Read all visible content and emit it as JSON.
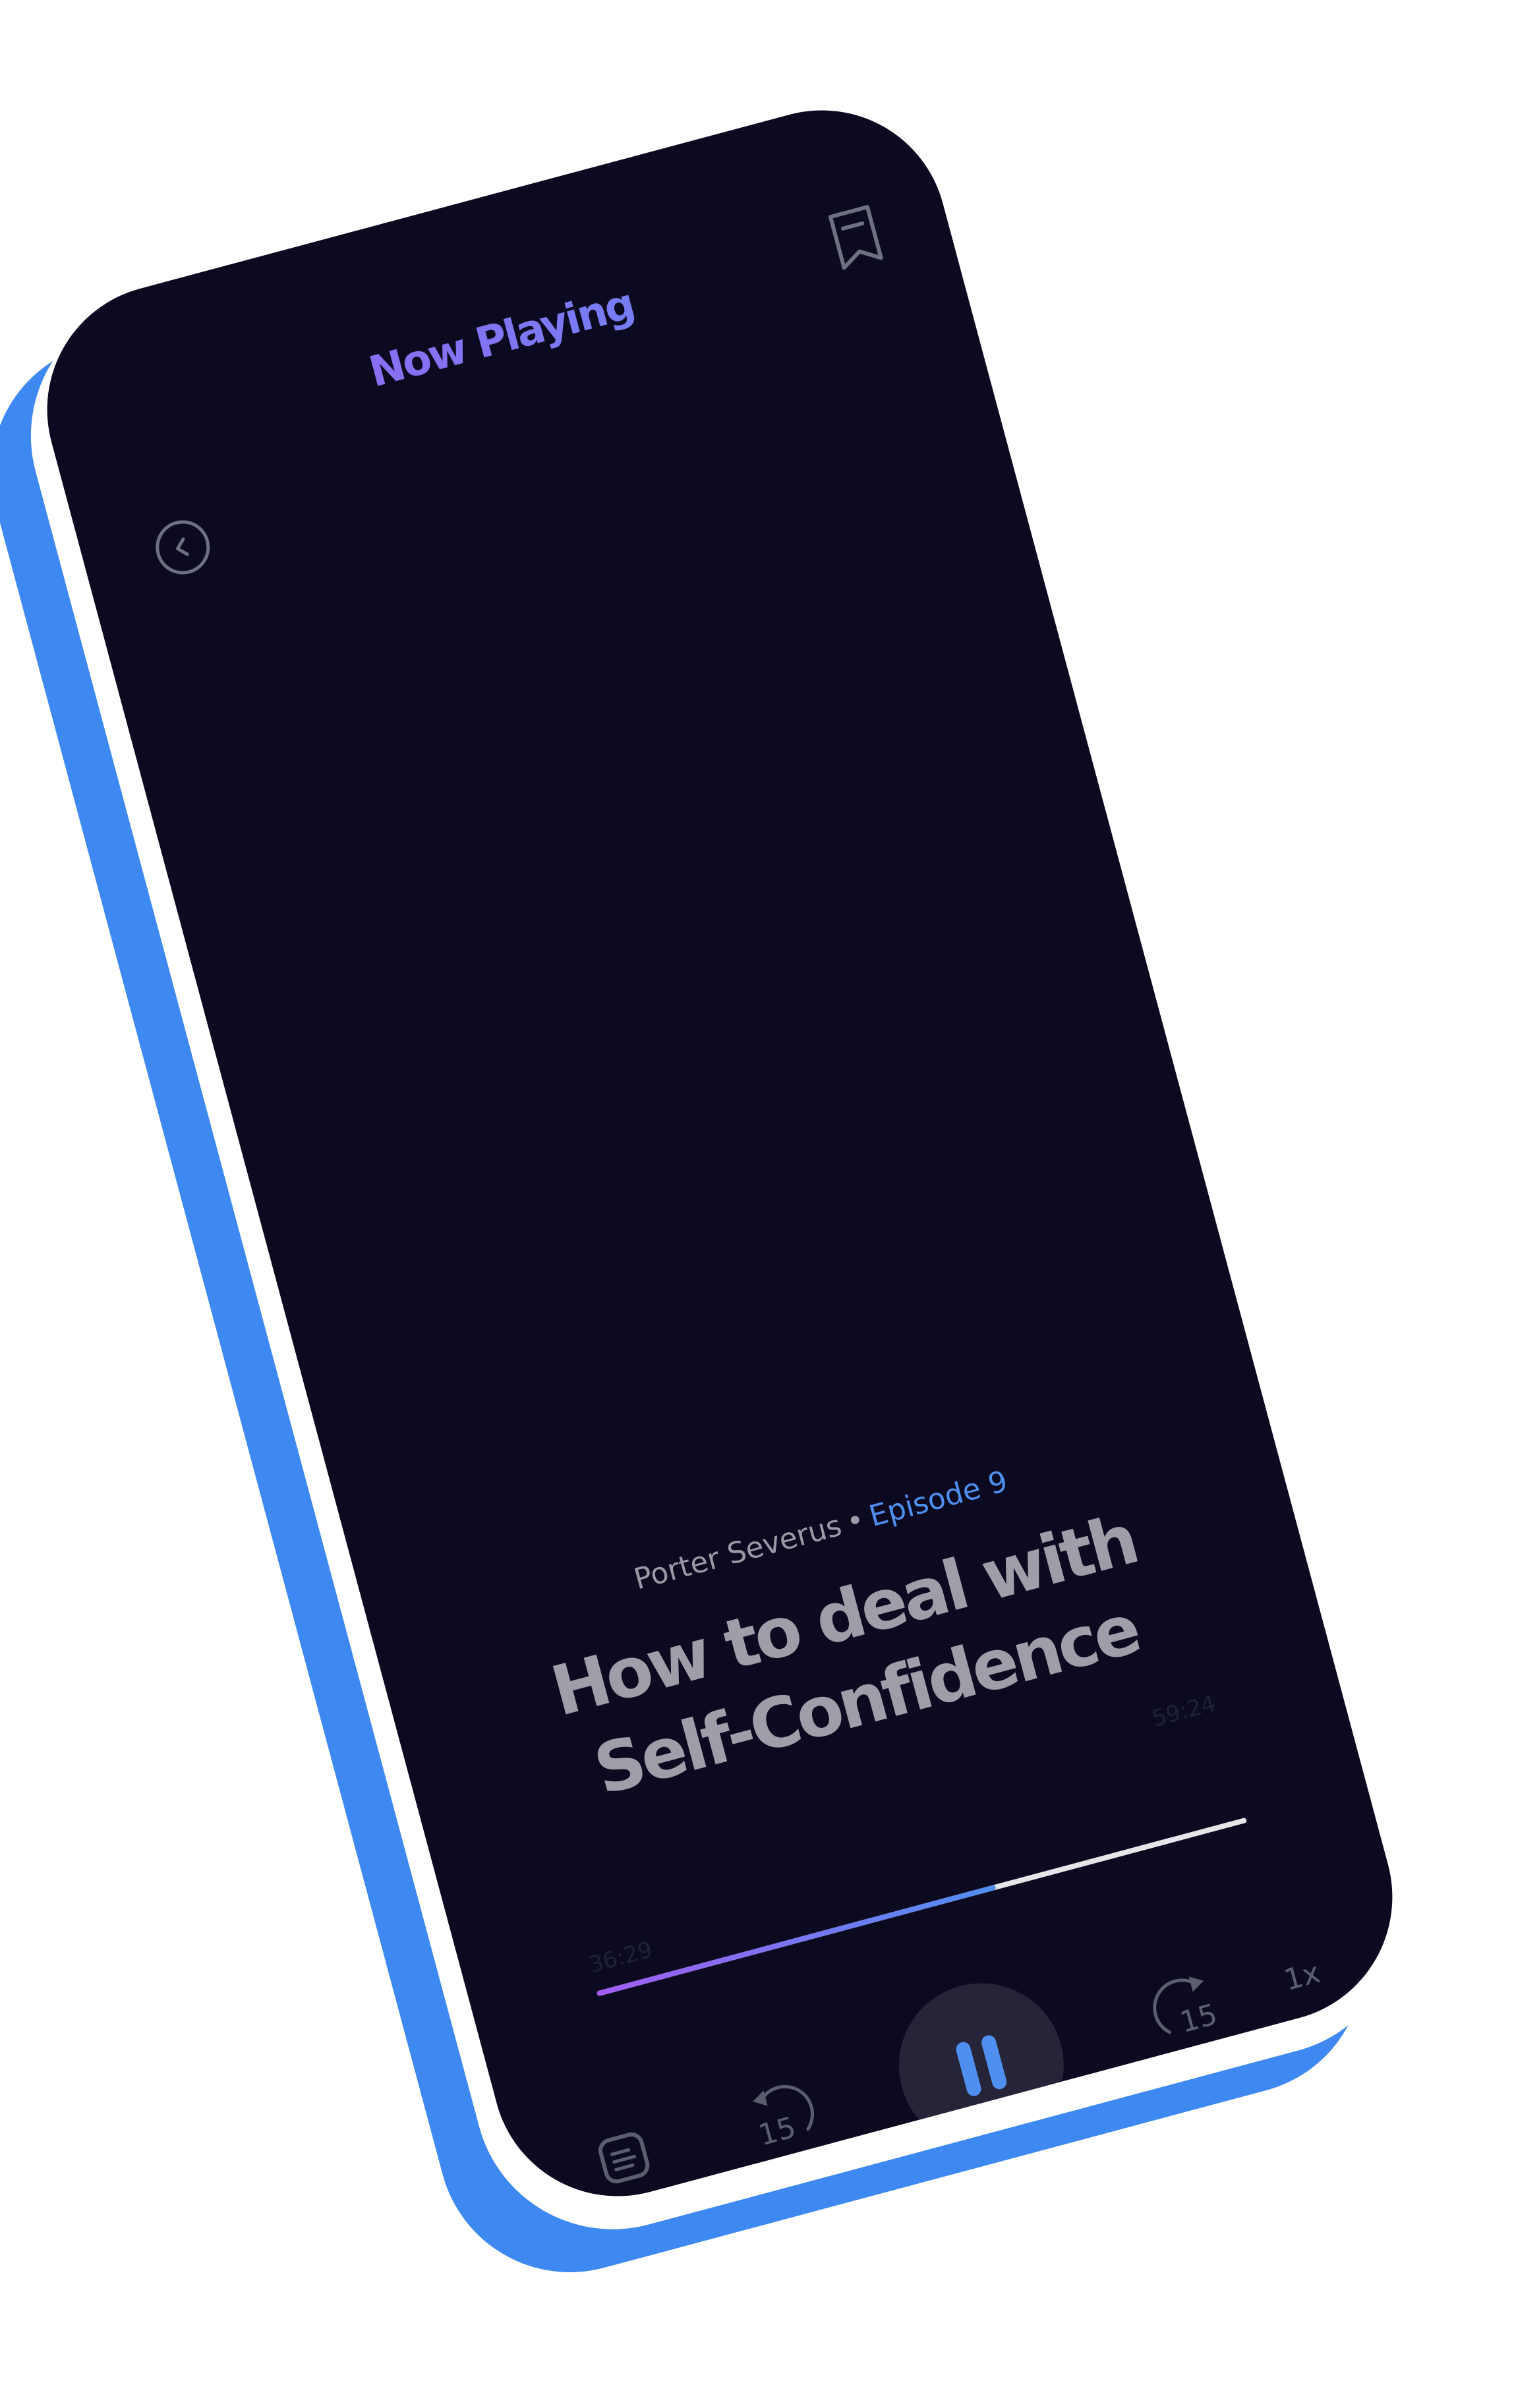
{
  "header": {
    "title": "Now Playing",
    "back_icon": "chevron-left-circle-icon",
    "bookmark_icon": "bookmark-icon"
  },
  "episode": {
    "author": "Porter Severus",
    "separator": "•",
    "episode_label": "Episode 9",
    "title": "How to deal with Self-Confidence"
  },
  "player": {
    "current_time": "36:29",
    "total_time": "59:24",
    "progress": 0.6142,
    "rewind_seconds": "15",
    "forward_seconds": "15",
    "speed": "1x",
    "play_state": "playing"
  },
  "colors": {
    "screen_bg": "#0c0a21",
    "shell_blue": "#3e88f2",
    "accent_blue": "#4f8ff0",
    "accent_purple": "#a35cf2",
    "play_button_bg": "#262438"
  }
}
